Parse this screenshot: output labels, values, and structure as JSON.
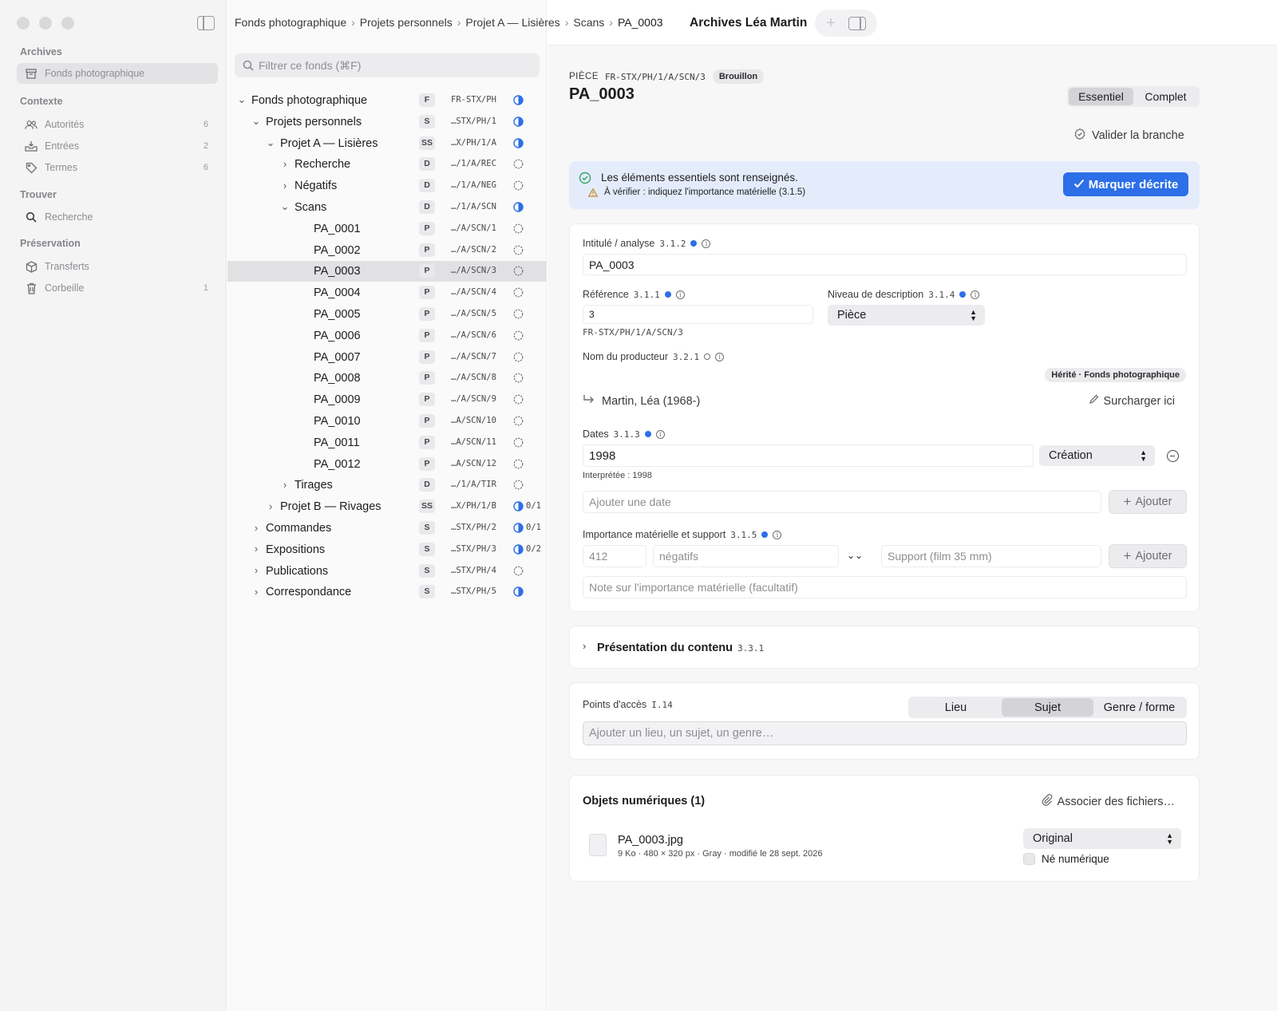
{
  "sidebar": {
    "sections": [
      {
        "title": "Archives",
        "items": [
          {
            "label": "Fonds photographique",
            "count": "",
            "icon": "archive-box-icon",
            "selected": true
          }
        ]
      },
      {
        "title": "Contexte",
        "items": [
          {
            "label": "Autorités",
            "count": "6",
            "icon": "people-icon"
          },
          {
            "label": "Entrées",
            "count": "2",
            "icon": "inbox-tray-icon"
          },
          {
            "label": "Termes",
            "count": "6",
            "icon": "tag-icon"
          }
        ]
      },
      {
        "title": "Trouver",
        "items": [
          {
            "label": "Recherche",
            "count": "",
            "icon": "search-icon"
          }
        ]
      },
      {
        "title": "Préservation",
        "items": [
          {
            "label": "Transferts",
            "count": "",
            "icon": "package-icon"
          },
          {
            "label": "Corbeille",
            "count": "1",
            "icon": "trash-icon"
          }
        ]
      }
    ]
  },
  "breadcrumb": [
    "Fonds photographique",
    "Projets personnels",
    "Projet A — Lisières",
    "Scans",
    "PA_0003"
  ],
  "window_title": "Archives Léa Martin",
  "filter": {
    "placeholder": "Filtrer ce fonds (⌘F)"
  },
  "tree": [
    {
      "label": "Fonds photographique",
      "level": "F",
      "ref": "FR-STX/PH",
      "status": "half",
      "indent": 0,
      "chevron": "down",
      "progress": ""
    },
    {
      "label": "Projets personnels",
      "level": "S",
      "ref": "…STX/PH/1",
      "status": "half",
      "indent": 1,
      "chevron": "down",
      "progress": ""
    },
    {
      "label": "Projet A — Lisières",
      "level": "SS",
      "ref": "…X/PH/1/A",
      "status": "half",
      "indent": 2,
      "chevron": "down",
      "progress": ""
    },
    {
      "label": "Recherche",
      "level": "D",
      "ref": "…/1/A/REC",
      "status": "empty",
      "indent": 3,
      "chevron": "right",
      "progress": ""
    },
    {
      "label": "Négatifs",
      "level": "D",
      "ref": "…/1/A/NEG",
      "status": "empty",
      "indent": 3,
      "chevron": "right",
      "progress": ""
    },
    {
      "label": "Scans",
      "level": "D",
      "ref": "…/1/A/SCN",
      "status": "half",
      "indent": 3,
      "chevron": "down",
      "progress": ""
    },
    {
      "label": "PA_0001",
      "level": "P",
      "ref": "…/A/SCN/1",
      "status": "empty",
      "indent": 4,
      "chevron": "",
      "progress": ""
    },
    {
      "label": "PA_0002",
      "level": "P",
      "ref": "…/A/SCN/2",
      "status": "empty",
      "indent": 4,
      "chevron": "",
      "progress": ""
    },
    {
      "label": "PA_0003",
      "level": "P",
      "ref": "…/A/SCN/3",
      "status": "empty",
      "indent": 4,
      "chevron": "",
      "progress": "",
      "selected": true
    },
    {
      "label": "PA_0004",
      "level": "P",
      "ref": "…/A/SCN/4",
      "status": "empty",
      "indent": 4,
      "chevron": "",
      "progress": ""
    },
    {
      "label": "PA_0005",
      "level": "P",
      "ref": "…/A/SCN/5",
      "status": "empty",
      "indent": 4,
      "chevron": "",
      "progress": ""
    },
    {
      "label": "PA_0006",
      "level": "P",
      "ref": "…/A/SCN/6",
      "status": "empty",
      "indent": 4,
      "chevron": "",
      "progress": ""
    },
    {
      "label": "PA_0007",
      "level": "P",
      "ref": "…/A/SCN/7",
      "status": "empty",
      "indent": 4,
      "chevron": "",
      "progress": ""
    },
    {
      "label": "PA_0008",
      "level": "P",
      "ref": "…/A/SCN/8",
      "status": "empty",
      "indent": 4,
      "chevron": "",
      "progress": ""
    },
    {
      "label": "PA_0009",
      "level": "P",
      "ref": "…/A/SCN/9",
      "status": "empty",
      "indent": 4,
      "chevron": "",
      "progress": ""
    },
    {
      "label": "PA_0010",
      "level": "P",
      "ref": "…A/SCN/10",
      "status": "empty",
      "indent": 4,
      "chevron": "",
      "progress": ""
    },
    {
      "label": "PA_0011",
      "level": "P",
      "ref": "…A/SCN/11",
      "status": "empty",
      "indent": 4,
      "chevron": "",
      "progress": ""
    },
    {
      "label": "PA_0012",
      "level": "P",
      "ref": "…A/SCN/12",
      "status": "empty",
      "indent": 4,
      "chevron": "",
      "progress": ""
    },
    {
      "label": "Tirages",
      "level": "D",
      "ref": "…/1/A/TIR",
      "status": "empty",
      "indent": 3,
      "chevron": "right",
      "progress": ""
    },
    {
      "label": "Projet B — Rivages",
      "level": "SS",
      "ref": "…X/PH/1/B",
      "status": "half",
      "indent": 2,
      "chevron": "right",
      "progress": "0/1"
    },
    {
      "label": "Commandes",
      "level": "S",
      "ref": "…STX/PH/2",
      "status": "half",
      "indent": 1,
      "chevron": "right",
      "progress": "0/1"
    },
    {
      "label": "Expositions",
      "level": "S",
      "ref": "…STX/PH/3",
      "status": "half",
      "indent": 1,
      "chevron": "right",
      "progress": "0/2"
    },
    {
      "label": "Publications",
      "level": "S",
      "ref": "…STX/PH/4",
      "status": "empty",
      "indent": 1,
      "chevron": "right",
      "progress": ""
    },
    {
      "label": "Correspondance",
      "level": "S",
      "ref": "…STX/PH/5",
      "status": "half",
      "indent": 1,
      "chevron": "right",
      "progress": ""
    }
  ],
  "record": {
    "kind": "PIÈCE",
    "ref": "FR-STX/PH/1/A/SCN/3",
    "badge": "Brouillon",
    "title": "PA_0003",
    "view_modes": [
      "Essentiel",
      "Complet"
    ],
    "validate_label": "Valider la branche"
  },
  "banner": {
    "line1": "Les éléments essentiels sont renseignés.",
    "line2": "À vérifier : indiquez l'importance matérielle (3.1.5)",
    "button": "Marquer décrite"
  },
  "fields": {
    "title_label": "Intitulé / analyse",
    "title_num": "3.1.2",
    "title_value": "PA_0003",
    "ref_label": "Référence",
    "ref_num": "3.1.1",
    "ref_value": "3",
    "ref_full": "FR-STX/PH/1/A/SCN/3",
    "level_label": "Niveau de description",
    "level_num": "3.1.4",
    "level_value": "Pièce",
    "producer_label": "Nom du producteur",
    "producer_num": "3.2.1",
    "inherited": "Hérité · Fonds photographique",
    "producer_value": "Martin, Léa (1968-)",
    "override": "Surcharger ici",
    "dates_label": "Dates",
    "dates_num": "3.1.3",
    "date_value": "1998",
    "date_type": "Création",
    "date_interpreted": "Interprétée : 1998",
    "add_date_placeholder": "Ajouter une date",
    "add_label": "Ajouter",
    "extent_label": "Importance matérielle et support",
    "extent_num": "3.1.5",
    "extent_qty_placeholder": "412",
    "extent_unit_placeholder": "négatifs",
    "extent_support_placeholder": "Support (film 35 mm)",
    "extent_note_placeholder": "Note sur l'importance matérielle (facultatif)"
  },
  "content_section": {
    "title": "Présentation du contenu",
    "num": "3.3.1"
  },
  "access": {
    "label": "Points d'accès",
    "num": "I.14",
    "tabs": [
      "Lieu",
      "Sujet",
      "Genre / forme"
    ],
    "active": 1,
    "placeholder": "Ajouter un lieu, un sujet, un genre…"
  },
  "digital": {
    "title": "Objets numériques (1)",
    "attach": "Associer des fichiers…",
    "file_name": "PA_0003.jpg",
    "file_meta": "9 Ko · 480 × 320 px · Gray · modifié le 28 sept. 2026",
    "usage": "Original",
    "born_digital": "Né numérique"
  },
  "colors": {
    "accent": "#2c6fe8",
    "banner": "#e4ecfb"
  }
}
